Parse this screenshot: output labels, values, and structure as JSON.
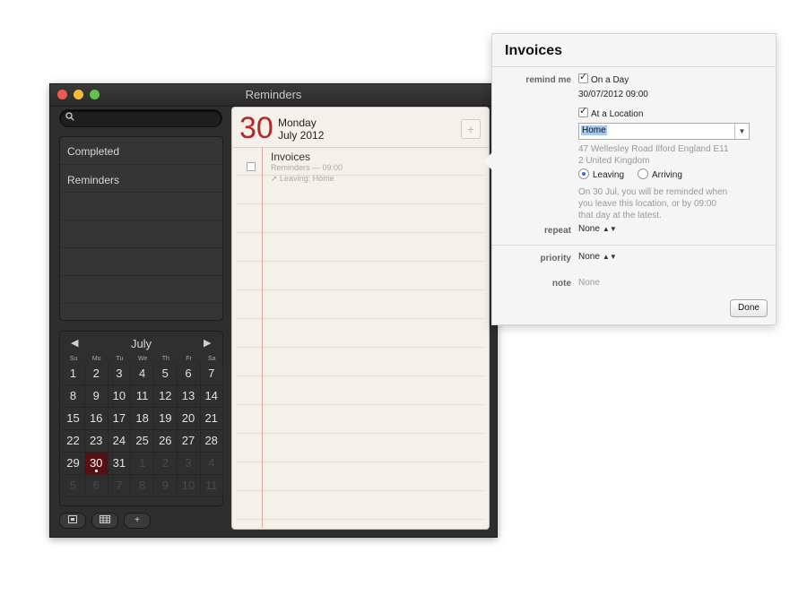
{
  "window": {
    "title": "Reminders"
  },
  "sidebar": {
    "lists": [
      {
        "label": "Completed"
      },
      {
        "label": "Reminders"
      }
    ],
    "bottom_buttons": [
      "card-icon",
      "calendar-grid-icon",
      "+"
    ]
  },
  "calendar": {
    "month": "July",
    "prev_arrow": "◀",
    "next_arrow": "▶",
    "weekdays": [
      "Su",
      "Mo",
      "Tu",
      "We",
      "Th",
      "Fr",
      "Sa"
    ],
    "weeks": [
      [
        "1",
        "2",
        "3",
        "4",
        "5",
        "6",
        "7"
      ],
      [
        "8",
        "9",
        "10",
        "11",
        "12",
        "13",
        "14"
      ],
      [
        "15",
        "16",
        "17",
        "18",
        "19",
        "20",
        "21"
      ],
      [
        "22",
        "23",
        "24",
        "25",
        "26",
        "27",
        "28"
      ],
      [
        "29",
        "30",
        "31",
        "1",
        "2",
        "3",
        "4"
      ],
      [
        "5",
        "6",
        "7",
        "8",
        "9",
        "10",
        "11"
      ]
    ],
    "selected_day": "30"
  },
  "paper": {
    "big_date": "30",
    "weekday": "Monday",
    "month_year": "July 2012",
    "add_label": "+",
    "reminder": {
      "title": "Invoices",
      "subtitle": "Reminders — 09:00",
      "location": "Leaving: Home"
    }
  },
  "popover": {
    "title": "Invoices",
    "remind_me_label": "remind me",
    "on_day_label": "On a Day",
    "date_time": "30/07/2012  09:00",
    "at_location_label": "At a Location",
    "location_value": "Home",
    "address_line1": "47 Wellesley Road Ilford England E11",
    "address_line2": "2 United Kingdom",
    "leaving_label": "Leaving",
    "arriving_label": "Arriving",
    "note_line1": "On 30 Jul, you will be reminded when",
    "note_line2": "you leave this location, or by 09:00",
    "note_line3": "that day at the latest.",
    "repeat_label": "repeat",
    "repeat_value": "None",
    "priority_label": "priority",
    "priority_value": "None",
    "note_label": "note",
    "note_value": "None",
    "done_label": "Done"
  }
}
